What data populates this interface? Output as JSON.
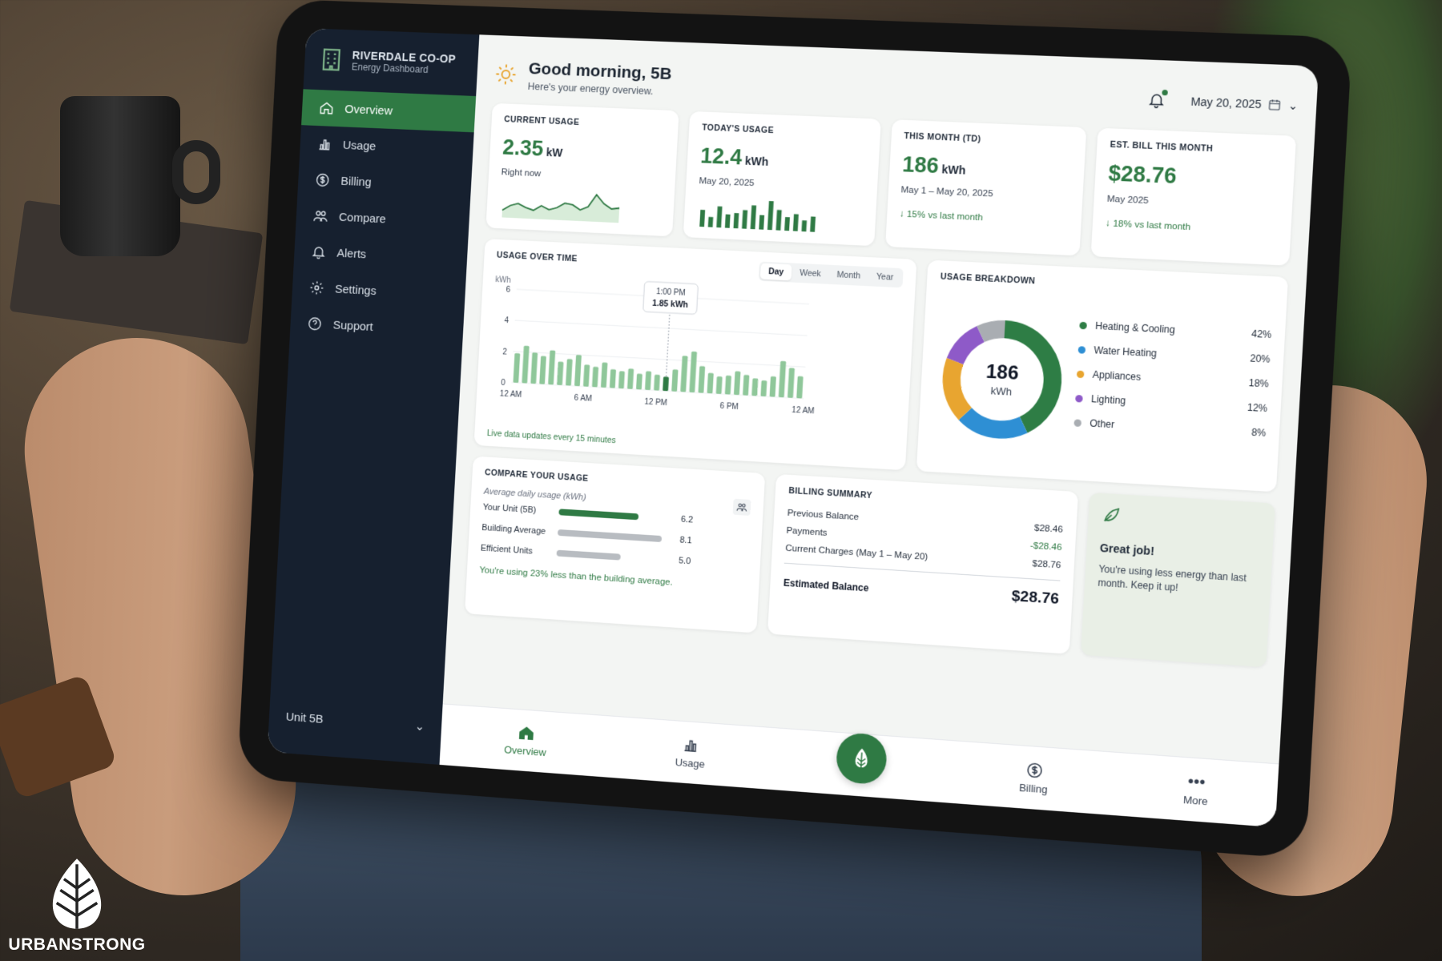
{
  "brand": {
    "title": "RIVERDALE CO-OP",
    "subtitle": "Energy Dashboard"
  },
  "sidebar": {
    "items": [
      {
        "label": "Overview",
        "icon": "home-icon",
        "active": true
      },
      {
        "label": "Usage",
        "icon": "bar-chart-icon",
        "active": false
      },
      {
        "label": "Billing",
        "icon": "dollar-icon",
        "active": false
      },
      {
        "label": "Compare",
        "icon": "people-icon",
        "active": false
      },
      {
        "label": "Alerts",
        "icon": "bell-icon",
        "active": false
      },
      {
        "label": "Settings",
        "icon": "gear-icon",
        "active": false
      },
      {
        "label": "Support",
        "icon": "help-icon",
        "active": false
      }
    ],
    "unit": "Unit 5B"
  },
  "header": {
    "greeting": "Good morning, 5B",
    "subtitle": "Here's your energy overview.",
    "date": "May 20, 2025"
  },
  "stats": [
    {
      "title": "CURRENT USAGE",
      "value": "2.35",
      "unit": "kW",
      "sub": "Right now",
      "delta": ""
    },
    {
      "title": "TODAY'S USAGE",
      "value": "12.4",
      "unit": "kWh",
      "sub": "May 20, 2025",
      "delta": ""
    },
    {
      "title": "THIS MONTH (TD)",
      "value": "186",
      "unit": "kWh",
      "sub": "May 1 – May 20, 2025",
      "delta": "↓ 15% vs last month"
    },
    {
      "title": "EST. BILL THIS MONTH",
      "value": "$28.76",
      "unit": "",
      "sub": "May 2025",
      "delta": "↓ 18% vs last month"
    }
  ],
  "usage_over_time": {
    "title": "USAGE OVER TIME",
    "tabs": [
      "Day",
      "Week",
      "Month",
      "Year"
    ],
    "active_tab": "Day",
    "tooltip": {
      "time": "1:00 PM",
      "value": "1.85 kWh"
    },
    "note": "Live data updates every 15 minutes"
  },
  "breakdown": {
    "title": "USAGE BREAKDOWN",
    "total": "186",
    "total_unit": "kWh",
    "items": [
      {
        "label": "Heating & Cooling",
        "pct": "42%",
        "value": 42,
        "color": "#2e7d45"
      },
      {
        "label": "Water Heating",
        "pct": "20%",
        "value": 20,
        "color": "#2e8fd4"
      },
      {
        "label": "Appliances",
        "pct": "18%",
        "value": 18,
        "color": "#e8a530"
      },
      {
        "label": "Lighting",
        "pct": "12%",
        "value": 12,
        "color": "#8e5ac8"
      },
      {
        "label": "Other",
        "pct": "8%",
        "value": 8,
        "color": "#a9adb2"
      }
    ]
  },
  "compare": {
    "title": "COMPARE YOUR USAGE",
    "subtitle": "Average daily usage (kWh)",
    "rows": [
      {
        "label": "Your Unit (5B)",
        "value": "6.2",
        "num": 6.2,
        "color": "#2f7a44"
      },
      {
        "label": "Building Average",
        "value": "8.1",
        "num": 8.1,
        "color": "#b8bcc1"
      },
      {
        "label": "Efficient Units",
        "value": "5.0",
        "num": 5.0,
        "color": "#b8bcc1"
      }
    ],
    "note": "You're using 23% less than the building average."
  },
  "billing": {
    "title": "BILLING SUMMARY",
    "rows": [
      {
        "label": "Previous Balance",
        "amount": "$28.46"
      },
      {
        "label": "Payments",
        "amount": "-$28.46"
      },
      {
        "label": "Current Charges (May 1 – May 20)",
        "amount": "$28.76"
      }
    ],
    "total_label": "Estimated Balance",
    "total_amount": "$28.76"
  },
  "tip": {
    "title": "Great job!",
    "body": "You're using less energy than last month. Keep it up!"
  },
  "bottom_nav": [
    {
      "label": "Overview",
      "active": true
    },
    {
      "label": "Usage",
      "active": false
    },
    {
      "label": "Billing",
      "active": false
    },
    {
      "label": "More",
      "active": false
    }
  ],
  "watermark": "URBANSTRONG",
  "chart_data": [
    {
      "type": "bar",
      "title": "USAGE OVER TIME",
      "ylabel": "kWh",
      "ylim": [
        0,
        6
      ],
      "yticks": [
        "0",
        "2",
        "4",
        "6"
      ],
      "xticks": [
        "12 AM",
        "6 AM",
        "12 PM",
        "6 PM",
        "12 AM"
      ],
      "values": [
        1.9,
        2.4,
        2.0,
        1.8,
        2.2,
        1.5,
        1.7,
        2.0,
        1.4,
        1.3,
        1.6,
        1.2,
        1.1,
        1.3,
        1.0,
        1.2,
        1.0,
        0.9,
        1.4,
        2.3,
        2.6,
        1.7,
        1.3,
        1.1,
        1.2,
        1.5,
        1.3,
        1.1,
        1.0,
        1.3,
        2.3,
        1.9,
        1.4
      ],
      "highlight_index": 17,
      "grid": true
    },
    {
      "type": "line",
      "title": "CURRENT USAGE",
      "values": [
        0.6,
        1.0,
        1.2,
        0.9,
        0.7,
        1.1,
        0.8,
        1.0,
        1.4,
        1.3,
        0.9,
        1.2,
        2.2,
        1.5,
        1.1,
        1.2
      ]
    },
    {
      "type": "bar",
      "title": "TODAY'S USAGE",
      "values": [
        2,
        1.2,
        2.5,
        1.6,
        1.8,
        2.2,
        2.8,
        1.7,
        3.4,
        2.4,
        1.6,
        2.0,
        1.3,
        1.8
      ]
    },
    {
      "type": "pie",
      "title": "USAGE BREAKDOWN",
      "categories": [
        "Heating & Cooling",
        "Water Heating",
        "Appliances",
        "Lighting",
        "Other"
      ],
      "values": [
        42,
        20,
        18,
        12,
        8
      ]
    }
  ]
}
